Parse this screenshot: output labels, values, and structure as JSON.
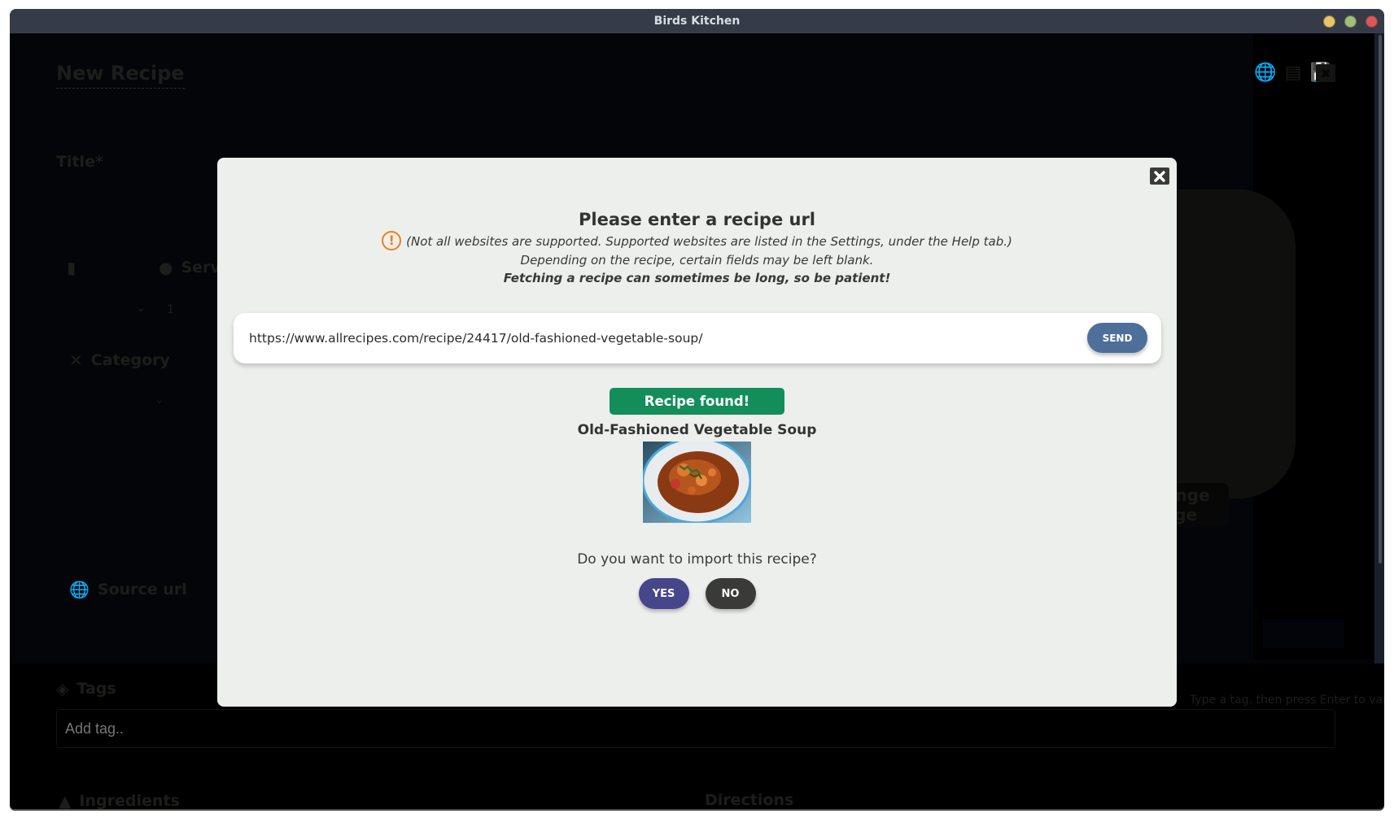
{
  "window": {
    "title": "Birds Kitchen",
    "controls": [
      {
        "name": "minimize",
        "color": "#e8c36a"
      },
      {
        "name": "maximize",
        "color": "#9fbf7a"
      },
      {
        "name": "close",
        "color": "#d9585a"
      }
    ]
  },
  "background": {
    "page_title": "New Recipe",
    "title_label": "Title*",
    "servings_label": "Servings",
    "servings_value": "1",
    "category_label": "Category",
    "source_url_label": "Source url",
    "change_image_label": "Change image",
    "tags_label": "Tags",
    "tags_placeholder": "Add tag..",
    "tags_help": "Type a tag, then press Enter to validate",
    "ingredients_label": "Ingredients",
    "directions_label": "Directions"
  },
  "modal": {
    "title": "Please enter a recipe url",
    "notice_line1": "(Not all websites are supported. Supported websites are listed in the Settings, under the Help tab.)",
    "notice_line2": "Depending on the recipe, certain fields may be left blank.",
    "notice_line3": "Fetching a recipe can sometimes be long, so be patient!",
    "url_value": "https://www.allrecipes.com/recipe/24417/old-fashioned-vegetable-soup/",
    "send_label": "SEND",
    "status_badge": "Recipe found!",
    "recipe_title": "Old-Fashioned Vegetable Soup",
    "recipe_image_alt": "Bowl of vegetable soup",
    "question": "Do you want to import this recipe?",
    "yes_label": "YES",
    "no_label": "NO"
  },
  "colors": {
    "send_button": "#4d6f9a",
    "status_badge": "#138e5b",
    "yes_button": "#46468a",
    "no_button": "#3a3b38",
    "warning": "#f07e1b"
  }
}
